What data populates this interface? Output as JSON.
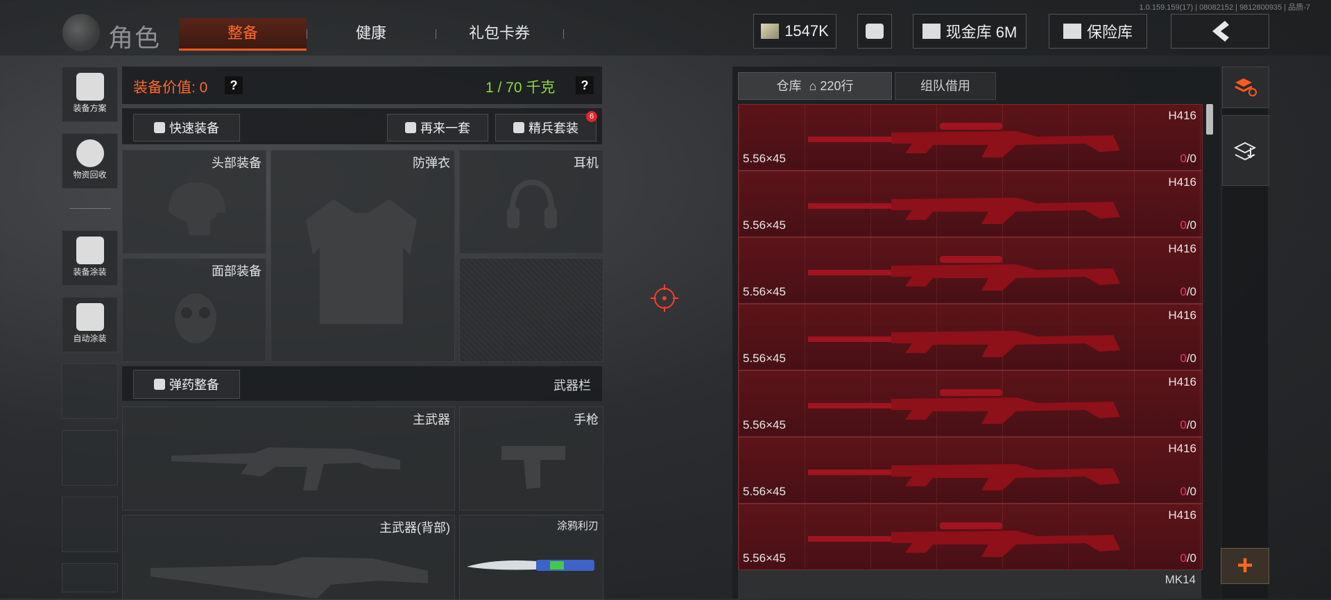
{
  "version_info": "1.0.159.159(17) | 08082152 | 9812800935 | 品质-7",
  "header": {
    "title": "角色",
    "tabs": [
      {
        "label": "整备",
        "active": true
      },
      {
        "label": "健康",
        "active": false
      },
      {
        "label": "礼包卡券",
        "active": false
      }
    ],
    "currency": "1547K",
    "cash_vault": "现金库 6M",
    "safe": "保险库"
  },
  "sidebar": {
    "items": [
      {
        "label": "装备方案",
        "icon": "helmet-gun-icon"
      },
      {
        "label": "物资回收",
        "icon": "recycle-icon"
      },
      {
        "label": "装备涂装",
        "icon": "paint-helmet-icon"
      },
      {
        "label": "自动涂装",
        "icon": "brush-gear-icon"
      }
    ]
  },
  "loadout": {
    "value_label": "装备价值: 0",
    "weight_label": "1 / 70 千克",
    "help": "?",
    "quick_equip": "快速装备",
    "repeat_set": "再来一套",
    "elite_set": "精兵套装",
    "elite_badge": "6",
    "slots": {
      "head": "头部装备",
      "armor": "防弹衣",
      "earphone": "耳机",
      "face": "面部装备",
      "ammo_btn": "弹药整备",
      "weapon_bar": "武器栏",
      "primary": "主武器",
      "pistol": "手枪",
      "primary_back": "主武器(背部)",
      "knife": "涂鸦利刃"
    }
  },
  "warehouse": {
    "tab_label": "仓库",
    "rows": "220行",
    "team_tab": "组队借用",
    "items": [
      {
        "name": "H416",
        "ammo": "5.56×45",
        "count": "0",
        "max": "/0"
      },
      {
        "name": "H416",
        "ammo": "5.56×45",
        "count": "0",
        "max": "/0"
      },
      {
        "name": "H416",
        "ammo": "5.56×45",
        "count": "0",
        "max": "/0"
      },
      {
        "name": "H416",
        "ammo": "5.56×45",
        "count": "0",
        "max": "/0"
      },
      {
        "name": "H416",
        "ammo": "5.56×45",
        "count": "0",
        "max": "/0"
      },
      {
        "name": "H416",
        "ammo": "5.56×45",
        "count": "0",
        "max": "/0"
      },
      {
        "name": "H416",
        "ammo": "5.56×45",
        "count": "0",
        "max": "/0"
      },
      {
        "name": "MK14",
        "ammo": "",
        "count": "",
        "max": ""
      }
    ]
  },
  "right_actions": {
    "plus": "+"
  },
  "colors": {
    "accent": "#ff6a2a",
    "weight_green": "#8fd83a",
    "item_red": "#5c1419",
    "count_pink": "#ff2b7a"
  }
}
